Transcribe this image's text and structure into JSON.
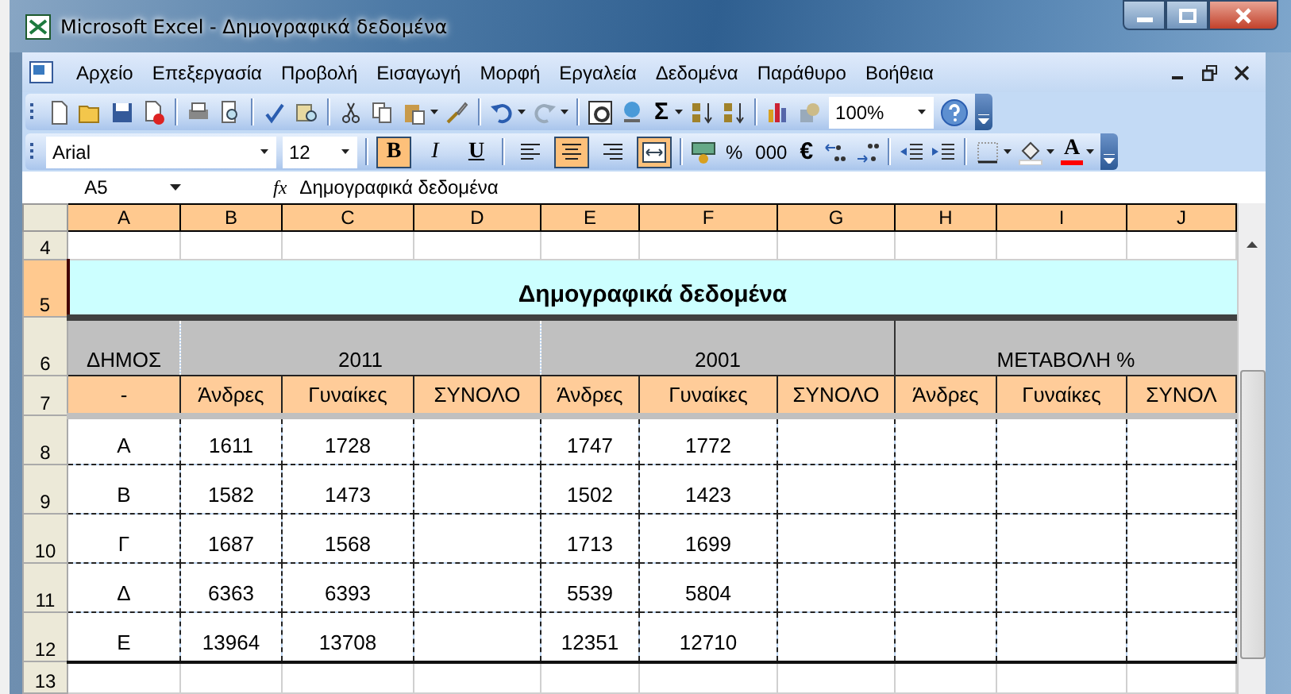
{
  "window": {
    "title": "Microsoft Excel - Δημογραφικά δεδομένα"
  },
  "menu": [
    "Αρχείο",
    "Επεξεργασία",
    "Προβολή",
    "Εισαγωγή",
    "Μορφή",
    "Εργαλεία",
    "Δεδομένα",
    "Παράθυρο",
    "Βοήθεια"
  ],
  "standard_toolbar": {
    "autosum": "Σ",
    "zoom": "100%"
  },
  "formatting_toolbar": {
    "font": "Arial",
    "size": "12",
    "styles": [
      {
        "kind": "bold",
        "label": "B",
        "on": true
      },
      {
        "kind": "italic",
        "label": "I",
        "on": false
      },
      {
        "kind": "underline",
        "label": "U",
        "on": false
      }
    ],
    "alignment": [
      {
        "kind": "left",
        "selected": false
      },
      {
        "kind": "center",
        "selected": true
      },
      {
        "kind": "right",
        "selected": false
      }
    ],
    "merge_center": {
      "on": true
    },
    "number_formats": [
      "%",
      "000",
      "€"
    ],
    "font_color": {
      "label": "A"
    }
  },
  "formula_bar": {
    "name_box": "A5",
    "function_label": "fx",
    "formula": "Δημογραφικά δεδομένα"
  },
  "sheet": {
    "columns": [
      {
        "label": "A",
        "selected": true
      },
      {
        "label": "B",
        "selected": true
      },
      {
        "label": "C",
        "selected": true
      },
      {
        "label": "D",
        "selected": true
      },
      {
        "label": "E",
        "selected": true
      },
      {
        "label": "F",
        "selected": true
      },
      {
        "label": "G",
        "selected": true
      },
      {
        "label": "H",
        "selected": true
      },
      {
        "label": "I",
        "selected": true
      },
      {
        "label": "J",
        "selected": true
      }
    ],
    "rows": [
      {
        "header": "4",
        "selected": false,
        "kind": "blank"
      },
      {
        "header": "5",
        "selected": true,
        "kind": "title",
        "text": "Δημογραφικά δεδομένα"
      },
      {
        "header": "6",
        "selected": false,
        "kind": "group",
        "label": "ΔΗΜΟΣ",
        "groups": [
          "2011",
          "2001",
          "ΜΕΤΑΒΟΛΗ %"
        ]
      },
      {
        "header": "7",
        "selected": false,
        "kind": "subheader",
        "cells": [
          "-",
          "Άνδρες",
          "Γυναίκες",
          "ΣΥΝΟΛΟ",
          "Άνδρες",
          "Γυναίκες",
          "ΣΥΝΟΛΟ",
          "Άνδρες",
          "Γυναίκες",
          "ΣΥΝΟΛ"
        ]
      },
      {
        "header": "8",
        "selected": false,
        "kind": "data",
        "district": "Α",
        "y2011": [
          "1611",
          "1728"
        ],
        "y2001": [
          "1747",
          "1772"
        ]
      },
      {
        "header": "9",
        "selected": false,
        "kind": "data",
        "district": "Β",
        "y2011": [
          "1582",
          "1473"
        ],
        "y2001": [
          "1502",
          "1423"
        ]
      },
      {
        "header": "10",
        "selected": false,
        "kind": "data",
        "district": "Γ",
        "y2011": [
          "1687",
          "1568"
        ],
        "y2001": [
          "1713",
          "1699"
        ]
      },
      {
        "header": "11",
        "selected": false,
        "kind": "data",
        "district": "Δ",
        "y2011": [
          "6363",
          "6393"
        ],
        "y2001": [
          "5539",
          "5804"
        ]
      },
      {
        "header": "12",
        "selected": false,
        "kind": "data",
        "district": "Ε",
        "y2011": [
          "13964",
          "13708"
        ],
        "y2001": [
          "12351",
          "12710"
        ]
      },
      {
        "header": "13",
        "selected": false,
        "kind": "blank"
      }
    ]
  }
}
